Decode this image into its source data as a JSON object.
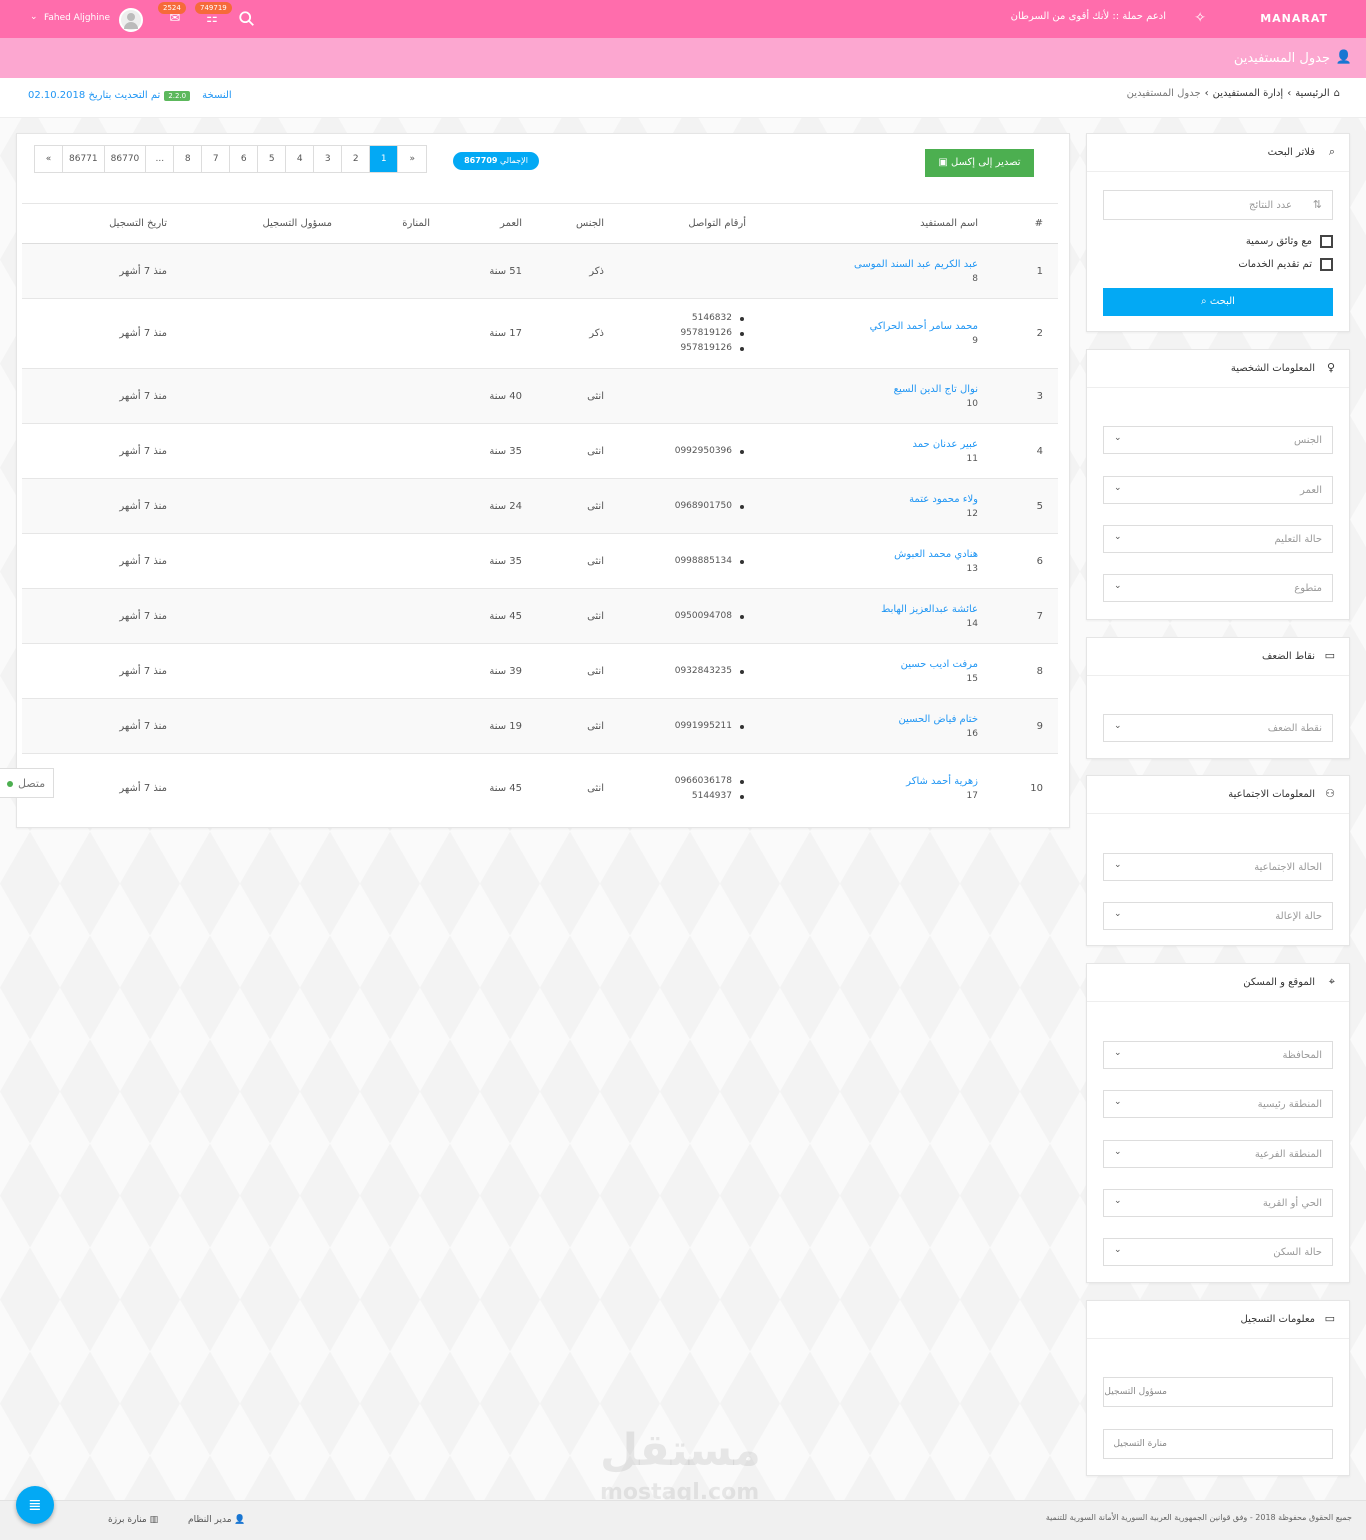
{
  "topbar": {
    "brand": "MANARAT",
    "campaign": "ادعم حملة :: لأنك أقوى من السرطان",
    "user": "Fahed Aljghine",
    "badge_messages": "2524",
    "badge_notifications": "749719"
  },
  "page": {
    "title": "جدول المستفيدين"
  },
  "breadcrumb": {
    "home": "الرئيسية",
    "section": "إدارة المستفيدين",
    "current": "جدول المستفيدين"
  },
  "version": {
    "label": "النسخة",
    "number": "2.2.0",
    "updated": "تم التحديث بتاريخ 02.10.2018"
  },
  "toolbar": {
    "export_label": "تصدير إلى إكسل",
    "total_label": "الإجمالي",
    "total_value": "867709",
    "pages": [
      "«",
      "86771",
      "86770",
      "...",
      "8",
      "7",
      "6",
      "5",
      "4",
      "3",
      "2",
      "1",
      "»"
    ]
  },
  "table": {
    "headers": {
      "idx": "#",
      "name": "اسم المستفيد",
      "phones": "أرقام التواصل",
      "gender": "الجنس",
      "age": "العمر",
      "lighthouse": "المنارة",
      "responsible": "مسؤول التسجيل",
      "date": "تاريخ التسجيل"
    },
    "rows": [
      {
        "idx": "1",
        "name": "عبد الكريم عبد السند الموسى",
        "id": "8",
        "phones": [],
        "gender": "ذكر",
        "age": "51 سنة",
        "lighthouse": "",
        "responsible": "",
        "date": "منذ 7 أشهر"
      },
      {
        "idx": "2",
        "name": "محمد سامر أحمد الحراكي",
        "id": "9",
        "phones": [
          "5146832",
          "957819126",
          "957819126"
        ],
        "gender": "ذكر",
        "age": "17 سنة",
        "lighthouse": "",
        "responsible": "",
        "date": "منذ 7 أشهر"
      },
      {
        "idx": "3",
        "name": "نوال تاج الدين السيع",
        "id": "10",
        "phones": [],
        "gender": "انثى",
        "age": "40 سنة",
        "lighthouse": "",
        "responsible": "",
        "date": "منذ 7 أشهر"
      },
      {
        "idx": "4",
        "name": "عبير عدنان حمد",
        "id": "11",
        "phones": [
          "0992950396"
        ],
        "gender": "انثى",
        "age": "35 سنة",
        "lighthouse": "",
        "responsible": "",
        "date": "منذ 7 أشهر"
      },
      {
        "idx": "5",
        "name": "ولاء محمود عتمة",
        "id": "12",
        "phones": [
          "0968901750"
        ],
        "gender": "انثى",
        "age": "24 سنة",
        "lighthouse": "",
        "responsible": "",
        "date": "منذ 7 أشهر"
      },
      {
        "idx": "6",
        "name": "هنادي محمد العبوش",
        "id": "13",
        "phones": [
          "0998885134"
        ],
        "gender": "انثى",
        "age": "35 سنة",
        "lighthouse": "",
        "responsible": "",
        "date": "منذ 7 أشهر"
      },
      {
        "idx": "7",
        "name": "عائشة عبدالعزيز الهابط",
        "id": "14",
        "phones": [
          "0950094708"
        ],
        "gender": "انثى",
        "age": "45 سنة",
        "lighthouse": "",
        "responsible": "",
        "date": "منذ 7 أشهر"
      },
      {
        "idx": "8",
        "name": "مرفت اديب حسين",
        "id": "15",
        "phones": [
          "0932843235"
        ],
        "gender": "انثى",
        "age": "39 سنة",
        "lighthouse": "",
        "responsible": "",
        "date": "منذ 7 أشهر"
      },
      {
        "idx": "9",
        "name": "ختام فياض الحسين",
        "id": "16",
        "phones": [
          "0991995211"
        ],
        "gender": "انثى",
        "age": "19 سنة",
        "lighthouse": "",
        "responsible": "",
        "date": "منذ 7 أشهر"
      },
      {
        "idx": "10",
        "name": "زهرية أحمد شاكر",
        "id": "17",
        "phones": [
          "0966036178",
          "5144937"
        ],
        "gender": "انثى",
        "age": "45 سنة",
        "lighthouse": "",
        "responsible": "",
        "date": "منذ 7 أشهر"
      }
    ]
  },
  "filters": {
    "title": "فلاتر البحث",
    "results_placeholder": "عدد النتائج",
    "check_documents": "مع وثائق رسمية",
    "check_services": "تم تقديم الخدمات",
    "search_label": "البحث"
  },
  "personal": {
    "title": "المعلومات الشخصية",
    "gender": "الجنس",
    "age": "العمر",
    "education": "حالة التعليم",
    "volunteer": "متطوع"
  },
  "weakness": {
    "title": "نقاط الضعف",
    "point": "نقطة الضعف"
  },
  "social": {
    "title": "المعلومات الاجتماعية",
    "marital": "الحالة الاجتماعية",
    "dependency": "حالة الإعالة"
  },
  "location": {
    "title": "الموقع و المسكن",
    "governorate": "المحافظة",
    "main_area": "المنطقة رئيسية",
    "sub_area": "المنطقة الفرعية",
    "neighborhood": "الحي أو القرية",
    "housing": "حالة السكن"
  },
  "registration": {
    "title": "معلومات التسجيل",
    "responsible": "مسؤول التسجيل",
    "lighthouse": "منارة التسجيل"
  },
  "status": {
    "online": "متصل"
  },
  "footer": {
    "copyright": "جميع الحقوق محفوظة 2018 - وفق قوانين الجمهورية العربية السورية الأمانة السورية للتنمية",
    "role": "مدير النظام",
    "branch": "منارة برزة"
  },
  "watermark": {
    "ar": "مستقل",
    "en": "mostaql.com"
  }
}
